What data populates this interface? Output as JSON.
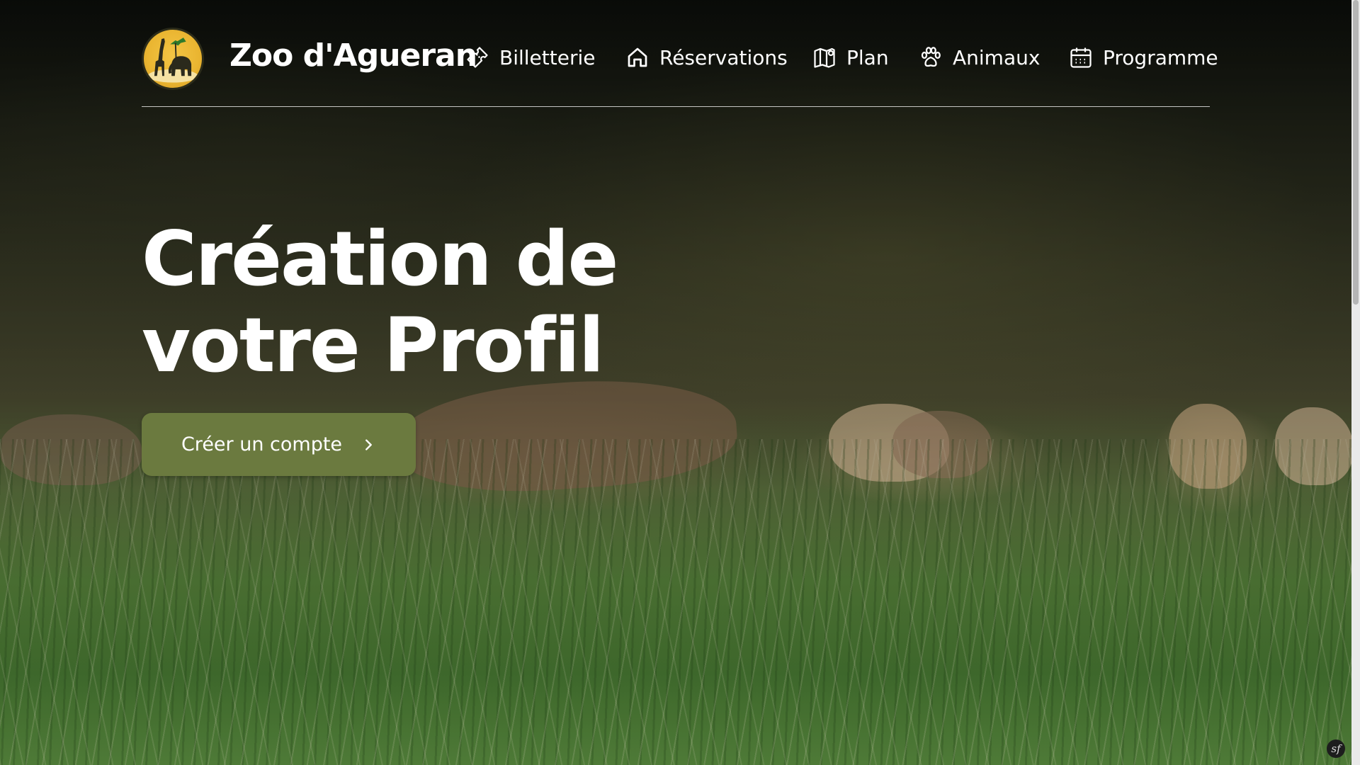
{
  "brand": {
    "name": "Zoo d'Agueran"
  },
  "nav": {
    "items": [
      {
        "label": "Billetterie",
        "icon": "ticket-icon"
      },
      {
        "label": "Réservations",
        "icon": "home-icon"
      },
      {
        "label": "Plan",
        "icon": "map-icon"
      },
      {
        "label": "Animaux",
        "icon": "paw-icon"
      },
      {
        "label": "Programme",
        "icon": "calendar-icon"
      }
    ]
  },
  "hero": {
    "title_line1": "Création de",
    "title_line2": "votre Profil",
    "cta_label": "Créer un compte",
    "cta_icon": "chevron-right-icon"
  },
  "colors": {
    "accent": "#6b7a3f",
    "logo_yellow": "#eab531",
    "text": "#ffffff"
  },
  "corner_badge": {
    "label": "sf"
  }
}
